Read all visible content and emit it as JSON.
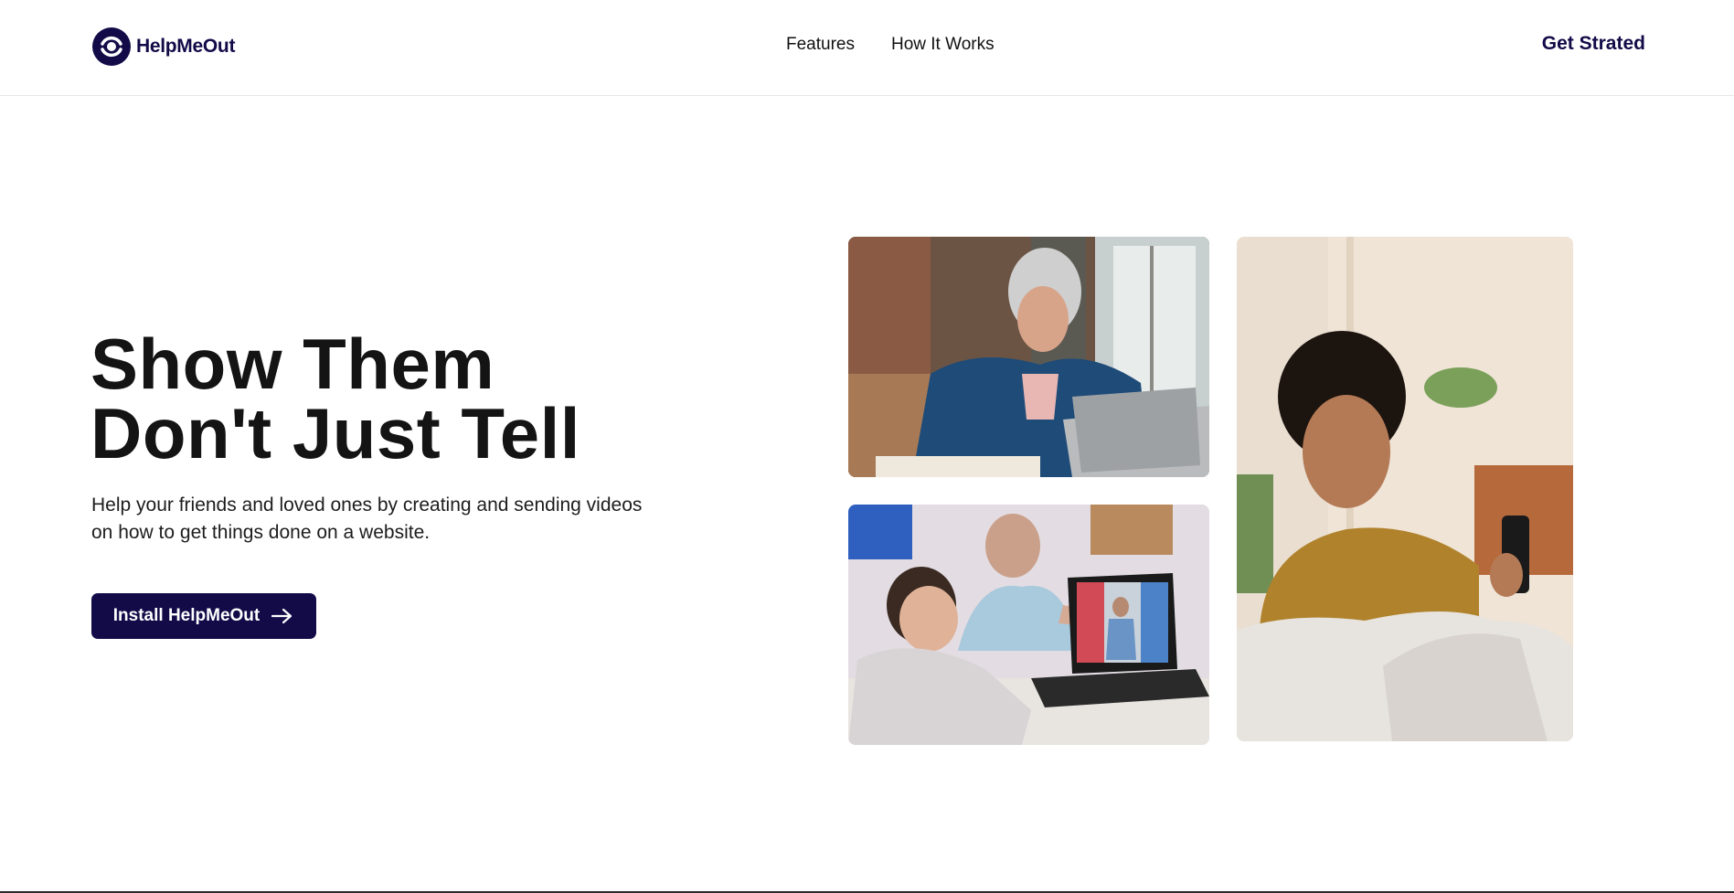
{
  "header": {
    "logo_text": "HelpMeOut",
    "logo_icon": "helpmeout-logo-icon",
    "nav": [
      {
        "label": "Features"
      },
      {
        "label": "How It Works"
      }
    ],
    "get_started_label": "Get Strated"
  },
  "hero": {
    "title_line1": "Show Them",
    "title_line2": "Don't Just Tell",
    "subtitle": "Help your friends and loved ones by creating and sending videos on how to get things done on a website.",
    "cta_label": "Install HelpMeOut",
    "cta_icon": "arrow-right-icon"
  },
  "images": [
    {
      "name": "woman-with-headphones-laptop-photo"
    },
    {
      "name": "grandfather-boy-laptop-video-call-photo"
    },
    {
      "name": "woman-smiling-at-phone-photo"
    }
  ],
  "colors": {
    "brand": "#120b48",
    "heading": "#141414",
    "background": "#ffffff",
    "divider": "#e6e6e6"
  }
}
